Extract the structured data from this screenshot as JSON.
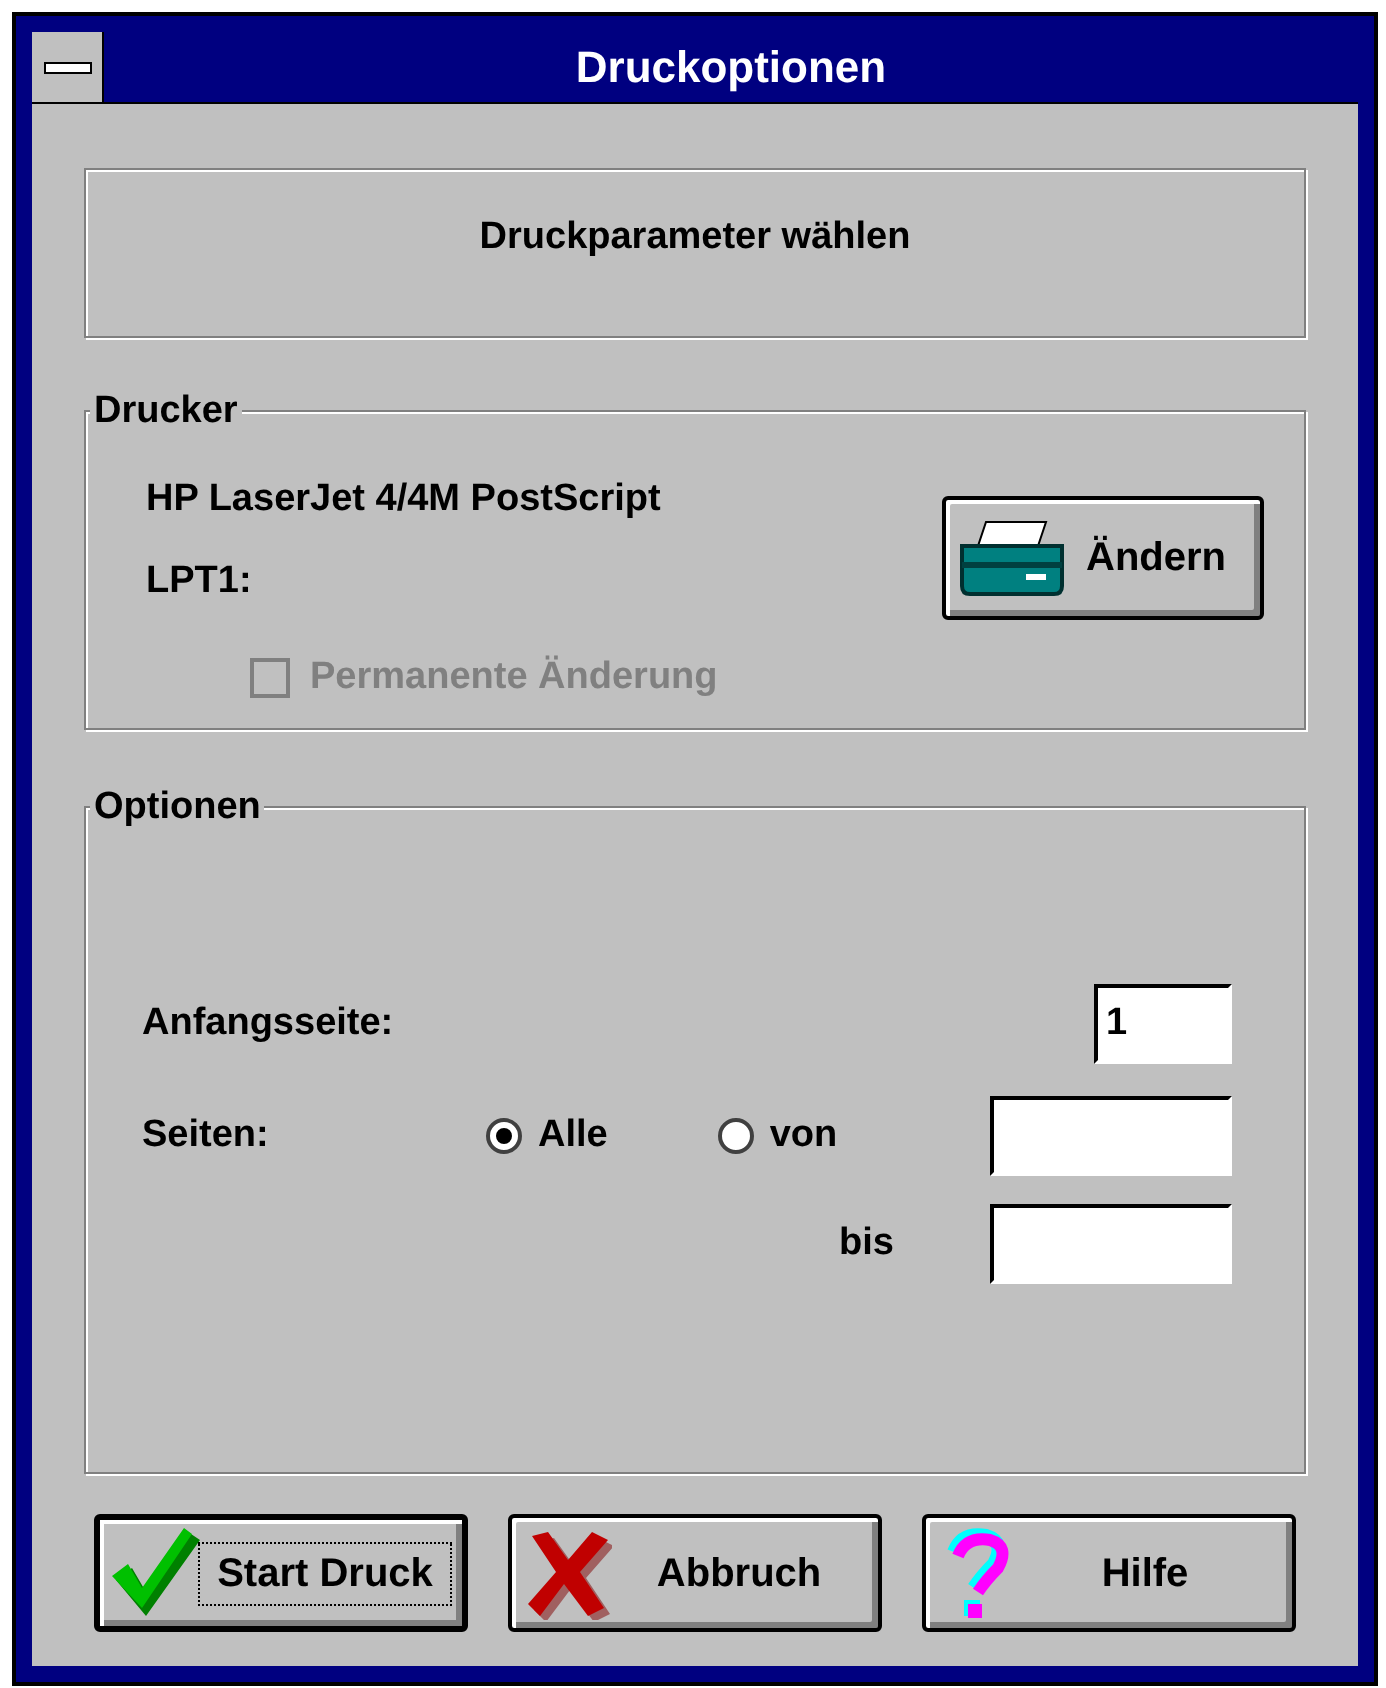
{
  "window": {
    "title": "Druckoptionen"
  },
  "header": "Druckparameter wählen",
  "printer_group": {
    "label": "Drucker",
    "printer_name": "HP LaserJet 4/4M PostScript",
    "port": "LPT1:",
    "change_button": "Ändern",
    "permanent_change": {
      "label": "Permanente Änderung",
      "checked": false,
      "disabled": true
    }
  },
  "options_group": {
    "label": "Optionen",
    "start_page": {
      "label": "Anfangsseite:",
      "value": "1"
    },
    "pages": {
      "label": "Seiten:",
      "choices": [
        {
          "label": "Alle",
          "selected": true
        },
        {
          "label": "von",
          "selected": false
        }
      ],
      "to_label": "bis"
    }
  },
  "buttons": [
    {
      "kind": "ok",
      "label": "Start Druck",
      "default": true
    },
    {
      "kind": "cancel",
      "label": "Abbruch",
      "default": false
    },
    {
      "kind": "help",
      "label": "Hilfe",
      "default": false
    }
  ]
}
